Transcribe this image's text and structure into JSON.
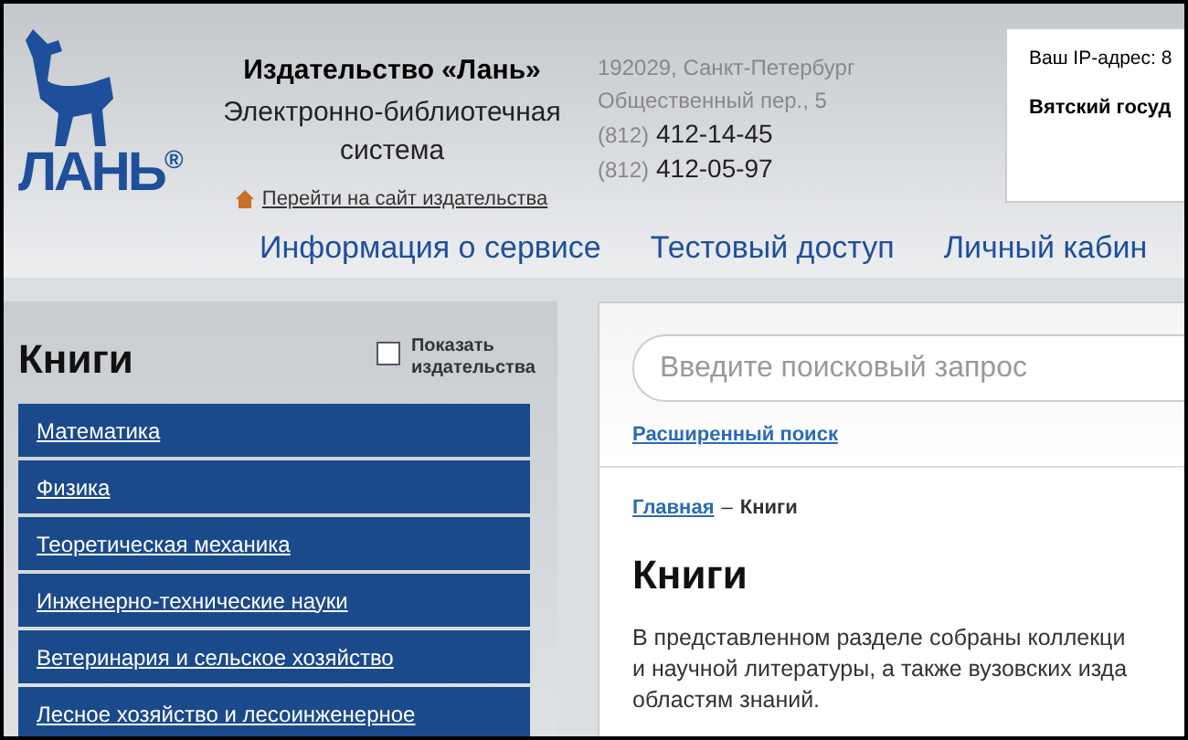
{
  "header": {
    "logo_text": "ЛАНЬ",
    "logo_mark": "®",
    "publisher": "Издательство «Лань»",
    "subtitle_lines": [
      "Электронно-библиотечная",
      "система"
    ],
    "site_link": "Перейти на сайт издательства",
    "address": [
      "192029, Санкт-Петербург",
      "Общественный пер., 5"
    ],
    "phones": [
      {
        "code": "(812)",
        "number": "412-14-45"
      },
      {
        "code": "(812)",
        "number": "412-05-97"
      }
    ],
    "ip_box": {
      "ip": "Ваш IP-адрес: 8",
      "org": "Вятский госуд"
    }
  },
  "nav": [
    "Информация о сервисе",
    "Тестовый доступ",
    "Личный кабин"
  ],
  "sidebar": {
    "title": "Книги",
    "show_publishers": {
      "label_lines": [
        "Показать",
        "издательства"
      ],
      "checked": false
    },
    "items": [
      "Математика",
      "Физика",
      "Теоретическая механика",
      "Инженерно-технические науки",
      "Ветеринария и сельское хозяйство",
      "Лесное хозяйство и лесоинженерное"
    ]
  },
  "content": {
    "search": {
      "placeholder": "Введите поисковый запрос"
    },
    "advanced_search": "Расширенный поиск",
    "breadcrumb": [
      {
        "label": "Главная",
        "link": true
      },
      {
        "label": "Книги",
        "link": false
      }
    ],
    "breadcrumb_separator": "–",
    "heading": "Книги",
    "text_lines": [
      "В представленном разделе собраны коллекци",
      "и научной литературы, а также вузовских изда",
      "областям знаний."
    ]
  }
}
